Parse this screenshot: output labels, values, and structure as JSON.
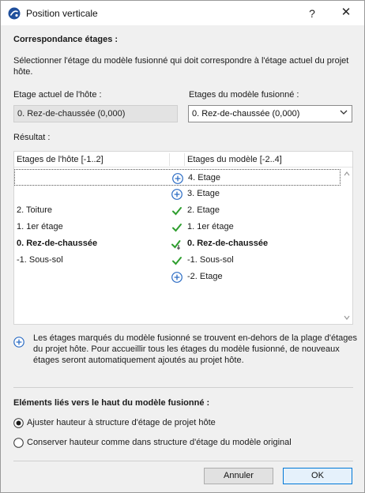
{
  "window": {
    "title": "Position verticale",
    "help_label": "?",
    "close_label": "✕"
  },
  "correspondence": {
    "title": "Correspondance étages :",
    "description": "Sélectionner l'étage du modèle fusionné qui doit correspondre à l'étage actuel du projet hôte."
  },
  "host_story": {
    "label": "Etage actuel de l'hôte :",
    "value": "0. Rez-de-chaussée (0,000)"
  },
  "merged_story": {
    "label": "Etages du modèle fusionné :",
    "value": "0. Rez-de-chaussée (0,000)"
  },
  "result": {
    "label": "Résultat :",
    "col_host": "Etages de l'hôte [-1..2]",
    "col_model": "Etages du modèle [-2..4]",
    "rows": [
      {
        "host": "",
        "mark": "plus-circle-icon",
        "model": "4. Etage",
        "bold": false,
        "focused": true
      },
      {
        "host": "",
        "mark": "plus-circle-icon",
        "model": "3. Etage",
        "bold": false,
        "focused": false
      },
      {
        "host": "2. Toiture",
        "mark": "checkmark-icon",
        "model": "2. Etage",
        "bold": false,
        "focused": false
      },
      {
        "host": "1. 1er étage",
        "mark": "checkmark-icon",
        "model": "1. 1er étage",
        "bold": false,
        "focused": false
      },
      {
        "host": "0. Rez-de-chaussée",
        "mark": "checkmark-anchor-icon",
        "model": "0. Rez-de-chaussée",
        "bold": true,
        "focused": false
      },
      {
        "host": "-1. Sous-sol",
        "mark": "checkmark-icon",
        "model": "-1. Sous-sol",
        "bold": false,
        "focused": false
      },
      {
        "host": "",
        "mark": "plus-circle-icon",
        "model": "-2. Etage",
        "bold": false,
        "focused": false
      }
    ]
  },
  "note": {
    "icon": "plus-circle-icon",
    "text": "Les étages marqués du modèle fusionné se trouvent en-dehors de la plage d'étages du projet hôte. Pour accueillir tous les étages du modèle fusionné, de nouveaux étages seront automatiquement ajoutés au projet hôte."
  },
  "linked": {
    "title": "Eléments liés vers le haut du modèle fusionné :",
    "options": [
      {
        "label": "Ajuster hauteur à structure d'étage de projet hôte",
        "selected": true
      },
      {
        "label": "Conserver hauteur comme dans structure d'étage du modèle original",
        "selected": false
      }
    ]
  },
  "buttons": {
    "cancel": "Annuler",
    "ok": "OK"
  },
  "colors": {
    "check": "#2e9e2e",
    "plus": "#2b6cc4",
    "accent": "#0078d7"
  }
}
